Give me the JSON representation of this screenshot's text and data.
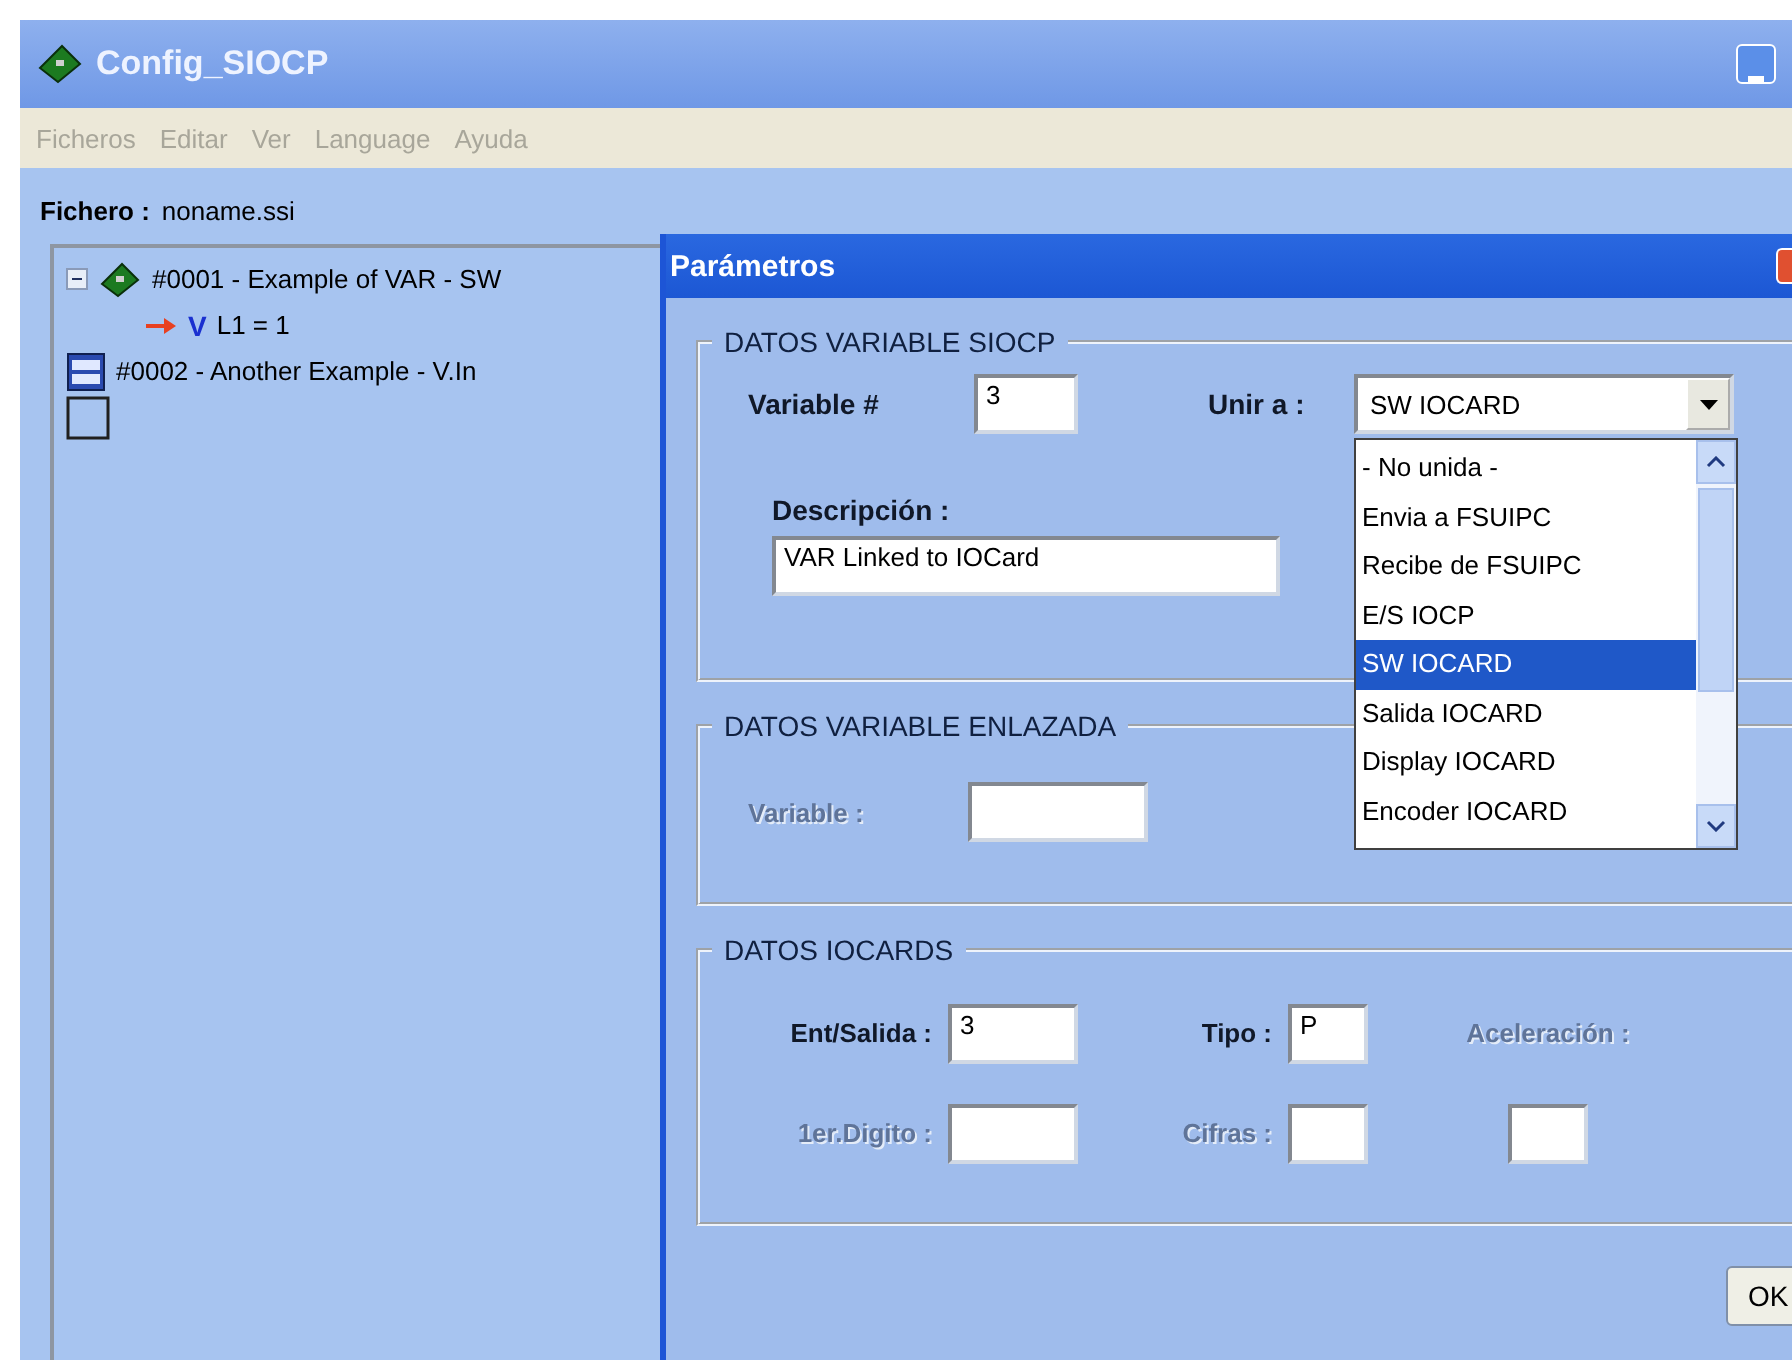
{
  "window": {
    "title": "Config_SIOCP"
  },
  "menu": [
    {
      "label": "Ficheros",
      "disabled": true
    },
    {
      "label": "Editar",
      "disabled": true
    },
    {
      "label": "Ver",
      "disabled": true
    },
    {
      "label": "Language",
      "disabled": true
    },
    {
      "label": "Ayuda",
      "disabled": true
    }
  ],
  "file": {
    "label": "Fichero :",
    "value": "noname.ssi"
  },
  "tree": [
    {
      "kind": "card",
      "text": "#0001 - Example of VAR - SW",
      "expanded": true,
      "children": [
        {
          "kind": "var",
          "marker": "V",
          "text": "L1 = 1"
        }
      ]
    },
    {
      "kind": "display",
      "text": "#0002 - Another Example - V.In"
    },
    {
      "kind": "empty"
    }
  ],
  "dialog": {
    "title": "Parámetros",
    "siocp": {
      "title": "DATOS VARIABLE SIOCP",
      "variable": {
        "label": "Variable #",
        "value": "3"
      },
      "link": {
        "label": "Unir a :",
        "value": "SW IOCARD",
        "expanded": true,
        "options": [
          {
            "label": "- No unida -",
            "selected": false
          },
          {
            "label": "Envia a FSUIPC",
            "selected": false
          },
          {
            "label": "Recibe de FSUIPC",
            "selected": false
          },
          {
            "label": "E/S IOCP",
            "selected": false
          },
          {
            "label": "SW IOCARD",
            "selected": true
          },
          {
            "label": "Salida IOCARD",
            "selected": false
          },
          {
            "label": "Display IOCARD",
            "selected": false
          },
          {
            "label": "Encoder IOCARD",
            "selected": false
          }
        ]
      },
      "description": {
        "label": "Descripción :",
        "value": "VAR Linked to IOCard"
      }
    },
    "linked": {
      "title": "DATOS VARIABLE ENLAZADA",
      "variable": {
        "label": "Variable :",
        "disabled": true
      }
    },
    "iocards": {
      "title": "DATOS IOCARDS",
      "io": {
        "label": "Ent/Salida :",
        "value": "3",
        "disabled": false
      },
      "type": {
        "label": "Tipo :",
        "value": "P",
        "disabled": false
      },
      "accel": {
        "label": "Aceleración :",
        "disabled": true
      },
      "first_digit": {
        "label": "1er.Digito :",
        "disabled": true
      },
      "digits": {
        "label": "Cifras :",
        "disabled": true
      }
    },
    "ok_button": "OK"
  }
}
